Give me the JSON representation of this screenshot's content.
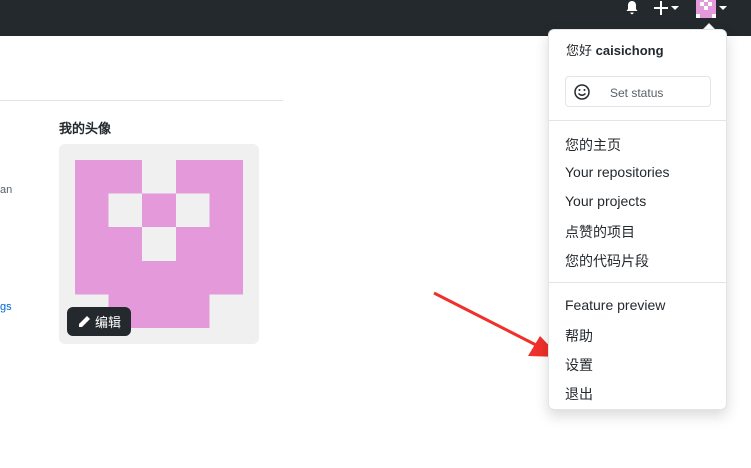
{
  "header": {
    "bell_icon": "bell-icon",
    "plus_icon": "plus-icon",
    "avatar_icon": "avatar-icon"
  },
  "left_panel": {
    "fragment_1": "an",
    "fragment_2": "gs"
  },
  "profile_picture": {
    "title": "我的头像",
    "edit_label": "编辑",
    "edit_icon": "pencil-icon",
    "colors": {
      "avatar": "#e49ada",
      "background": "#f0f0f0"
    }
  },
  "dropdown": {
    "greeting_prefix": "您好",
    "username": "caisichong",
    "set_status": "Set status",
    "status_icon": "smiley-icon",
    "items": [
      "您的主页",
      "Your repositories",
      "Your projects",
      "点赞的项目",
      "您的代码片段",
      "Feature preview",
      "帮助",
      "设置",
      "退出"
    ]
  },
  "annotation": {
    "arrow_color": "#f0302a",
    "arrow_icon": "red-arrow-icon"
  },
  "colors": {
    "header_bg": "#24292e",
    "link": "#0366d6"
  }
}
